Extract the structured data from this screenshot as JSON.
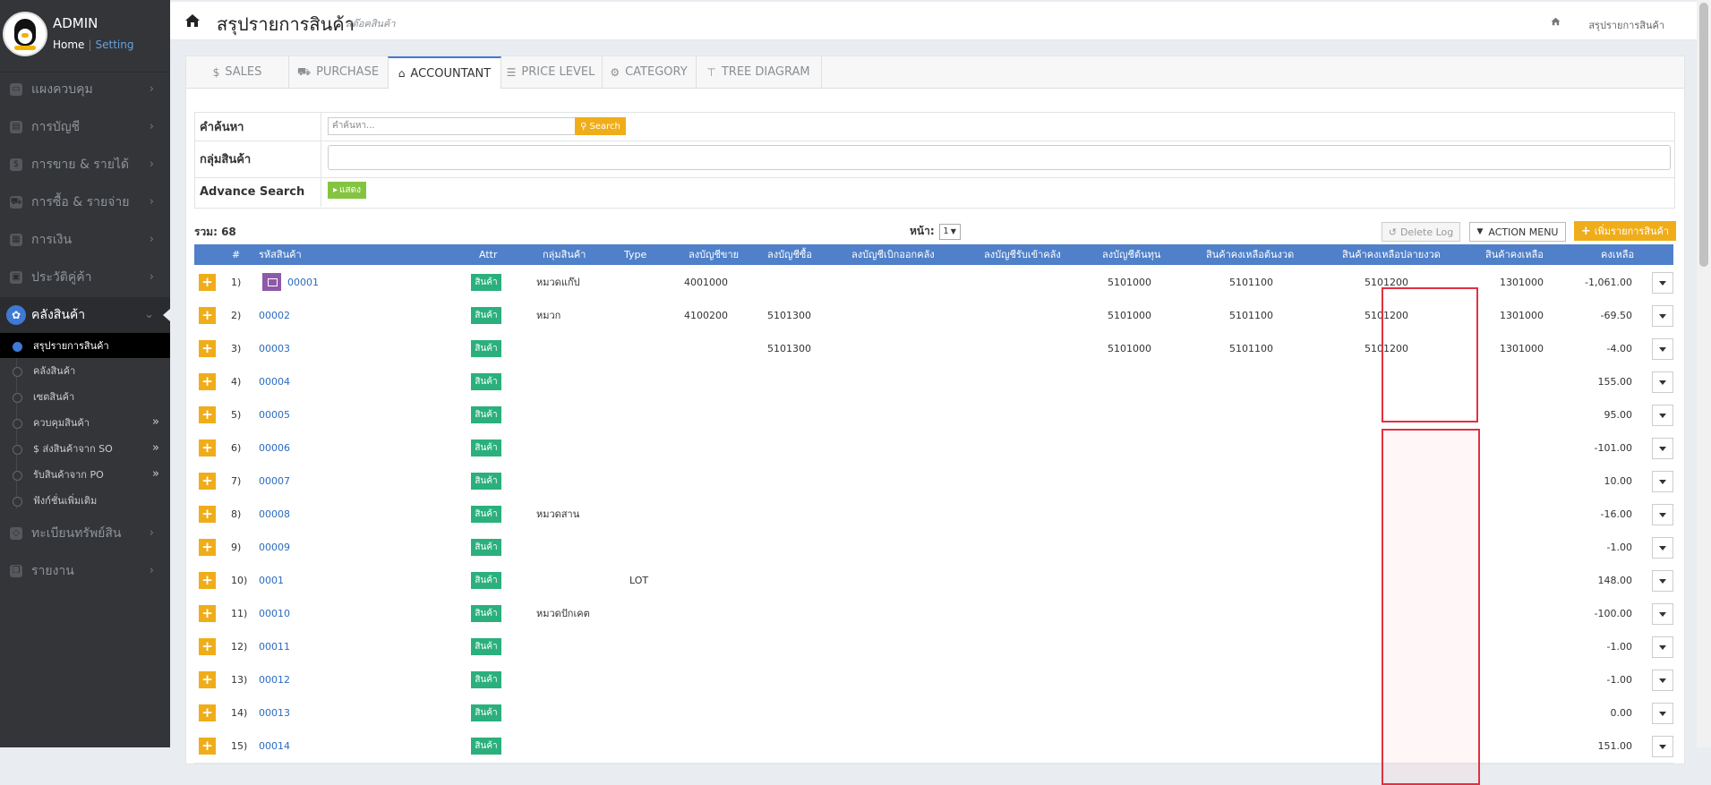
{
  "sidebar": {
    "admin_name": "ADMIN",
    "link_home": "Home",
    "link_sep": "|",
    "link_setting": "Setting",
    "nav": [
      {
        "label": "แผงควบคุม",
        "icon": "monitor-icon"
      },
      {
        "label": "การบัญชี",
        "icon": "book-icon"
      },
      {
        "label": "การขาย & รายได้",
        "icon": "dollar-icon"
      },
      {
        "label": "การซื้อ & รายจ่าย",
        "icon": "cart-icon"
      },
      {
        "label": "การเงิน",
        "icon": "calendar-icon"
      },
      {
        "label": "ประวัติคู่ค้า",
        "icon": "contact-icon"
      },
      {
        "label": "คลังสินค้า",
        "icon": "cubes-icon",
        "active": true
      },
      {
        "label": "ทะเบียนทรัพย์สิน",
        "icon": "diamond-icon"
      },
      {
        "label": "รายงาน",
        "icon": "copy-icon"
      }
    ],
    "sub": [
      {
        "label": "สรุปรายการสินค้า",
        "active": true
      },
      {
        "label": "คลังสินค้า"
      },
      {
        "label": "เซตสินค้า"
      },
      {
        "label": "ควบคุมสินค้า",
        "expand": "»"
      },
      {
        "label": "$ ส่งสินค้าจาก SO",
        "expand": "»"
      },
      {
        "label": "รับสินค้าจาก PO",
        "expand": "»"
      },
      {
        "label": "ฟังก์ชั่นเพิ่มเติม"
      }
    ]
  },
  "header": {
    "title": "สรุปรายการสินค้า",
    "subtitle": "สต๊อคสินค้า",
    "breadcrumb": "สรุปรายการสินค้า"
  },
  "tabs": [
    {
      "label": "SALES",
      "icon": "$"
    },
    {
      "label": "PURCHASE",
      "icon": "cart-icon"
    },
    {
      "label": "ACCOUNTANT",
      "icon": "graduation-cap-icon",
      "active": true
    },
    {
      "label": "PRICE LEVEL",
      "icon": "list-icon"
    },
    {
      "label": "CATEGORY",
      "icon": "gear-icon"
    },
    {
      "label": "TREE DIAGRAM",
      "icon": "sitemap-icon"
    }
  ],
  "search": {
    "label_search": "คำค้นหา",
    "placeholder": "คำค้นหา...",
    "search_btn": "Search",
    "label_group": "กลุ่มสินค้า",
    "label_advance": "Advance Search",
    "show_btn": "แสดง"
  },
  "list": {
    "total": "รวม: 68",
    "page_label": "หน้า:",
    "page_value": "1",
    "delete_log": "Delete Log",
    "action_menu": "ACTION MENU",
    "add_item": "เพิ่มรายการสินค้า"
  },
  "table": {
    "columns": [
      "#",
      "รหัสสินค้า",
      "Attr",
      "กลุ่มสินค้า",
      "Type",
      "ลงบัญชีขาย",
      "ลงบัญชีซื้อ",
      "ลงบัญชีเบิกออกคลัง",
      "ลงบัญชีรับเข้าคลัง",
      "ลงบัญชีต้นทุน",
      "สินค้าคงเหลือต้นงวด",
      "สินค้าคงเหลือปลายงวด",
      "สินค้าคงเหลือ",
      "คงเหลือ"
    ],
    "badge": "สินค้า",
    "rows": [
      {
        "n": "1)",
        "code": "00001",
        "img": true,
        "group": "หมวดแก๊ป",
        "type": "",
        "sale": "4001000",
        "buy": "",
        "cost": "5101000",
        "beg": "5101100",
        "end": "5101200",
        "inv": "1301000",
        "bal": "-1,061.00"
      },
      {
        "n": "2)",
        "code": "00002",
        "group": "หมวก",
        "type": "",
        "sale": "4100200",
        "buy": "5101300",
        "cost": "5101000",
        "beg": "5101100",
        "end": "5101200",
        "inv": "1301000",
        "bal": "-69.50"
      },
      {
        "n": "3)",
        "code": "00003",
        "group": "",
        "type": "",
        "sale": "",
        "buy": "5101300",
        "cost": "5101000",
        "beg": "5101100",
        "end": "5101200",
        "inv": "1301000",
        "bal": "-4.00"
      },
      {
        "n": "4)",
        "code": "00004",
        "group": "",
        "type": "",
        "sale": "",
        "buy": "",
        "cost": "",
        "beg": "",
        "end": "",
        "inv": "",
        "bal": "155.00"
      },
      {
        "n": "5)",
        "code": "00005",
        "group": "",
        "type": "",
        "sale": "",
        "buy": "",
        "cost": "",
        "beg": "",
        "end": "",
        "inv": "",
        "bal": "95.00"
      },
      {
        "n": "6)",
        "code": "00006",
        "group": "",
        "type": "",
        "sale": "",
        "buy": "",
        "cost": "",
        "beg": "",
        "end": "",
        "inv": "",
        "bal": "-101.00"
      },
      {
        "n": "7)",
        "code": "00007",
        "group": "",
        "type": "",
        "sale": "",
        "buy": "",
        "cost": "",
        "beg": "",
        "end": "",
        "inv": "",
        "bal": "10.00"
      },
      {
        "n": "8)",
        "code": "00008",
        "group": "หมวดสาน",
        "type": "",
        "sale": "",
        "buy": "",
        "cost": "",
        "beg": "",
        "end": "",
        "inv": "",
        "bal": "-16.00"
      },
      {
        "n": "9)",
        "code": "00009",
        "group": "",
        "type": "",
        "sale": "",
        "buy": "",
        "cost": "",
        "beg": "",
        "end": "",
        "inv": "",
        "bal": "-1.00"
      },
      {
        "n": "10)",
        "code": "0001",
        "group": "",
        "type": "LOT",
        "sale": "",
        "buy": "",
        "cost": "",
        "beg": "",
        "end": "",
        "inv": "",
        "bal": "148.00"
      },
      {
        "n": "11)",
        "code": "00010",
        "group": "หมวดปักเคต",
        "type": "",
        "sale": "",
        "buy": "",
        "cost": "",
        "beg": "",
        "end": "",
        "inv": "",
        "bal": "-100.00"
      },
      {
        "n": "12)",
        "code": "00011",
        "group": "",
        "type": "",
        "sale": "",
        "buy": "",
        "cost": "",
        "beg": "",
        "end": "",
        "inv": "",
        "bal": "-1.00"
      },
      {
        "n": "13)",
        "code": "00012",
        "group": "",
        "type": "",
        "sale": "",
        "buy": "",
        "cost": "",
        "beg": "",
        "end": "",
        "inv": "",
        "bal": "-1.00"
      },
      {
        "n": "14)",
        "code": "00013",
        "group": "",
        "type": "",
        "sale": "",
        "buy": "",
        "cost": "",
        "beg": "",
        "end": "",
        "inv": "",
        "bal": "0.00"
      },
      {
        "n": "15)",
        "code": "00014",
        "group": "",
        "type": "",
        "sale": "",
        "buy": "",
        "cost": "",
        "beg": "",
        "end": "",
        "inv": "",
        "bal": "151.00"
      }
    ]
  },
  "colors": {
    "accent": "#3f79d6",
    "header_blue": "#4f80c9",
    "orange": "#f0ad1a",
    "green": "#2bb07d",
    "highlight_red": "#e03141",
    "sidebar": "#333538"
  }
}
